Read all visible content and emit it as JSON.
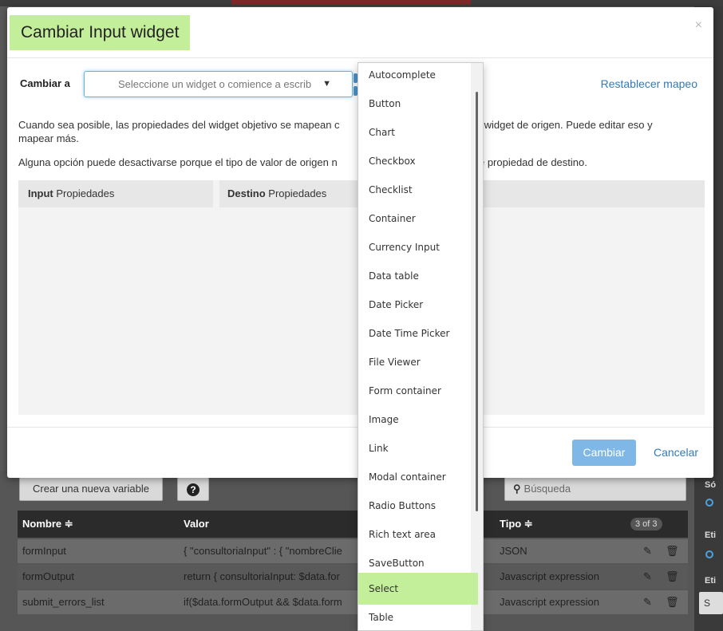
{
  "modal": {
    "title": "Cambiar Input widget",
    "close_label": "×",
    "change_to_label": "Cambiar a",
    "select_placeholder": "Seleccione un widget o comience a escrib",
    "reset_link": "Restablecer mapeo",
    "description_1": "Cuando sea posible, las propiedades del widget objetivo se mapean con las propiedades del widget de origen. Puede editar eso y mapear más.",
    "description_1_left": "Cuando sea posible, las propiedades del widget objetivo se mapean c",
    "description_1_right": "s del widget de origen. Puede editar eso y",
    "description_1_line2": "mapear más.",
    "description_2_left": "Alguna opción puede desactivarse porque el tipo de valor de origen n",
    "description_2_right": "po de propiedad de destino.",
    "props_source_bold": "Input",
    "props_source": " Propiedades",
    "props_target_bold": "Destino",
    "props_target": " Propiedades",
    "change_button": "Cambiar",
    "cancel_button": "Cancelar"
  },
  "dropdown": {
    "items": [
      "Autocomplete",
      "Button",
      "Chart",
      "Checkbox",
      "Checklist",
      "Container",
      "Currency Input",
      "Data table",
      "Date Picker",
      "Date Time Picker",
      "File Viewer",
      "Form container",
      "Image",
      "Link",
      "Modal container",
      "Radio Buttons",
      "Rich text area",
      "SaveButton",
      "Select",
      "Table"
    ],
    "selected": "Select"
  },
  "background": {
    "create_variable": "Crear una nueva variable",
    "help_icon": "?",
    "search_placeholder": "Búsqueda",
    "columns": {
      "name": "Nombre ≑",
      "value": "Valor",
      "type": "Tipo ≑",
      "count": "3 of 3"
    },
    "rows": [
      {
        "name": "formInput",
        "value": "{ \"consultoriaInput\" : { \"nombreClie",
        "type": "JSON"
      },
      {
        "name": "formOutput",
        "value": "return { consultoriaInput: $data.for",
        "type": "Javascript expression"
      },
      {
        "name": "submit_errors_list",
        "value": "if($data.formOutput && $data.form",
        "type": "Javascript expression"
      }
    ],
    "side_labels": [
      "Só",
      "Eti",
      "Eti"
    ],
    "side_input": "S"
  },
  "colors": {
    "highlight": "#c3ee9a",
    "link": "#337ab7",
    "primary_button": "#7fb8e6"
  },
  "icons": {
    "search": "search-icon",
    "help": "help-icon",
    "edit": "pencil-icon",
    "delete": "trash-icon",
    "close": "close-icon",
    "caret": "caret-down-icon"
  }
}
